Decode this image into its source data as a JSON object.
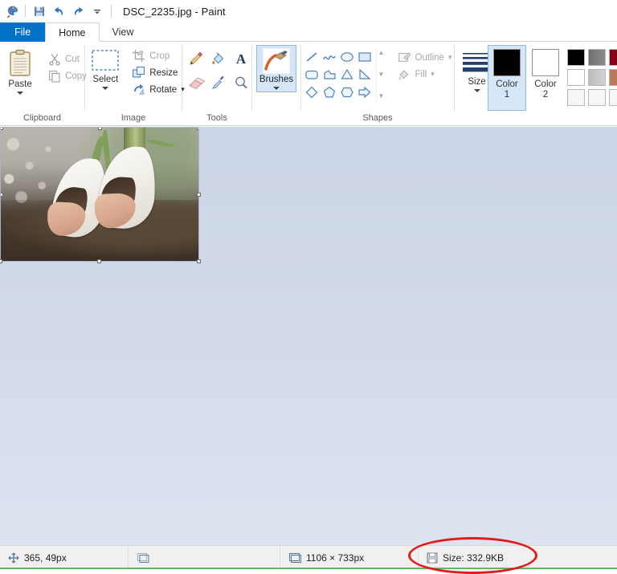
{
  "window": {
    "title": "DSC_2235.jpg - Paint",
    "app_icon": "paint-palette-icon",
    "quick_access": [
      {
        "name": "save-icon",
        "label": "Save"
      },
      {
        "name": "undo-icon",
        "label": "Undo"
      },
      {
        "name": "redo-icon",
        "label": "Redo"
      },
      {
        "name": "customize-quick-access-icon",
        "label": "Customize Quick Access Toolbar"
      }
    ]
  },
  "tabs": [
    {
      "label": "File",
      "state": "file"
    },
    {
      "label": "Home",
      "state": "active"
    },
    {
      "label": "View",
      "state": "normal"
    }
  ],
  "ribbon": {
    "clipboard": {
      "label": "Clipboard",
      "paste": "Paste",
      "cut": "Cut",
      "copy": "Copy"
    },
    "image": {
      "label": "Image",
      "select": "Select",
      "crop": "Crop",
      "resize": "Resize",
      "rotate": "Rotate"
    },
    "tools": {
      "label": "Tools",
      "items": [
        {
          "name": "pencil-icon",
          "label": "Pencil"
        },
        {
          "name": "fill-with-color-icon",
          "label": "Fill with color"
        },
        {
          "name": "text-icon",
          "label": "Text"
        },
        {
          "name": "eraser-icon",
          "label": "Eraser"
        },
        {
          "name": "color-picker-icon",
          "label": "Color picker"
        },
        {
          "name": "magnifier-icon",
          "label": "Magnifier"
        }
      ]
    },
    "brushes": {
      "label": "Brushes",
      "selected": true
    },
    "shapes": {
      "label": "Shapes",
      "outline": "Outline",
      "fill": "Fill",
      "items": [
        {
          "name": "shape-line",
          "label": "Line"
        },
        {
          "name": "shape-curve",
          "label": "Curve"
        },
        {
          "name": "shape-oval",
          "label": "Oval"
        },
        {
          "name": "shape-rectangle",
          "label": "Rectangle"
        },
        {
          "name": "shape-rounded-rectangle",
          "label": "Rounded rectangle"
        },
        {
          "name": "shape-polygon",
          "label": "Polygon"
        },
        {
          "name": "shape-triangle",
          "label": "Triangle"
        },
        {
          "name": "shape-right-triangle",
          "label": "Right triangle"
        },
        {
          "name": "shape-diamond",
          "label": "Diamond"
        },
        {
          "name": "shape-pentagon",
          "label": "Pentagon"
        },
        {
          "name": "shape-hexagon",
          "label": "Hexagon"
        },
        {
          "name": "shape-right-arrow",
          "label": "Right arrow"
        }
      ]
    },
    "size": {
      "label": "Size"
    },
    "colors": {
      "color1_label_line1": "Color",
      "color1_label_line2": "1",
      "color2_label_line1": "Color",
      "color2_label_line2": "2",
      "color1_value": "#000000",
      "color2_value": "#ffffff",
      "palette": [
        "#000000",
        "#7f7f7f",
        "#880015",
        "#ffffff",
        "#c3c3c3",
        "#b97a57",
        "#f6f6f6",
        "#f6f6f6",
        "#f6f6f6"
      ]
    }
  },
  "canvas": {
    "image_name": "DSC_2235.jpg",
    "selection_handles": 8
  },
  "statusbar": {
    "cursor_position": "365, 49px",
    "selection_size": "",
    "image_size": "1106 × 733px",
    "file_size": "Size: 332.9KB",
    "cursor_icon": "cursor-position-icon",
    "selection_icon": "selection-size-icon",
    "image_icon": "image-size-icon",
    "file_icon": "save-small-icon"
  },
  "annotation": {
    "type": "ellipse",
    "color": "#e01b1b",
    "target": "Size: 332.9KB"
  }
}
